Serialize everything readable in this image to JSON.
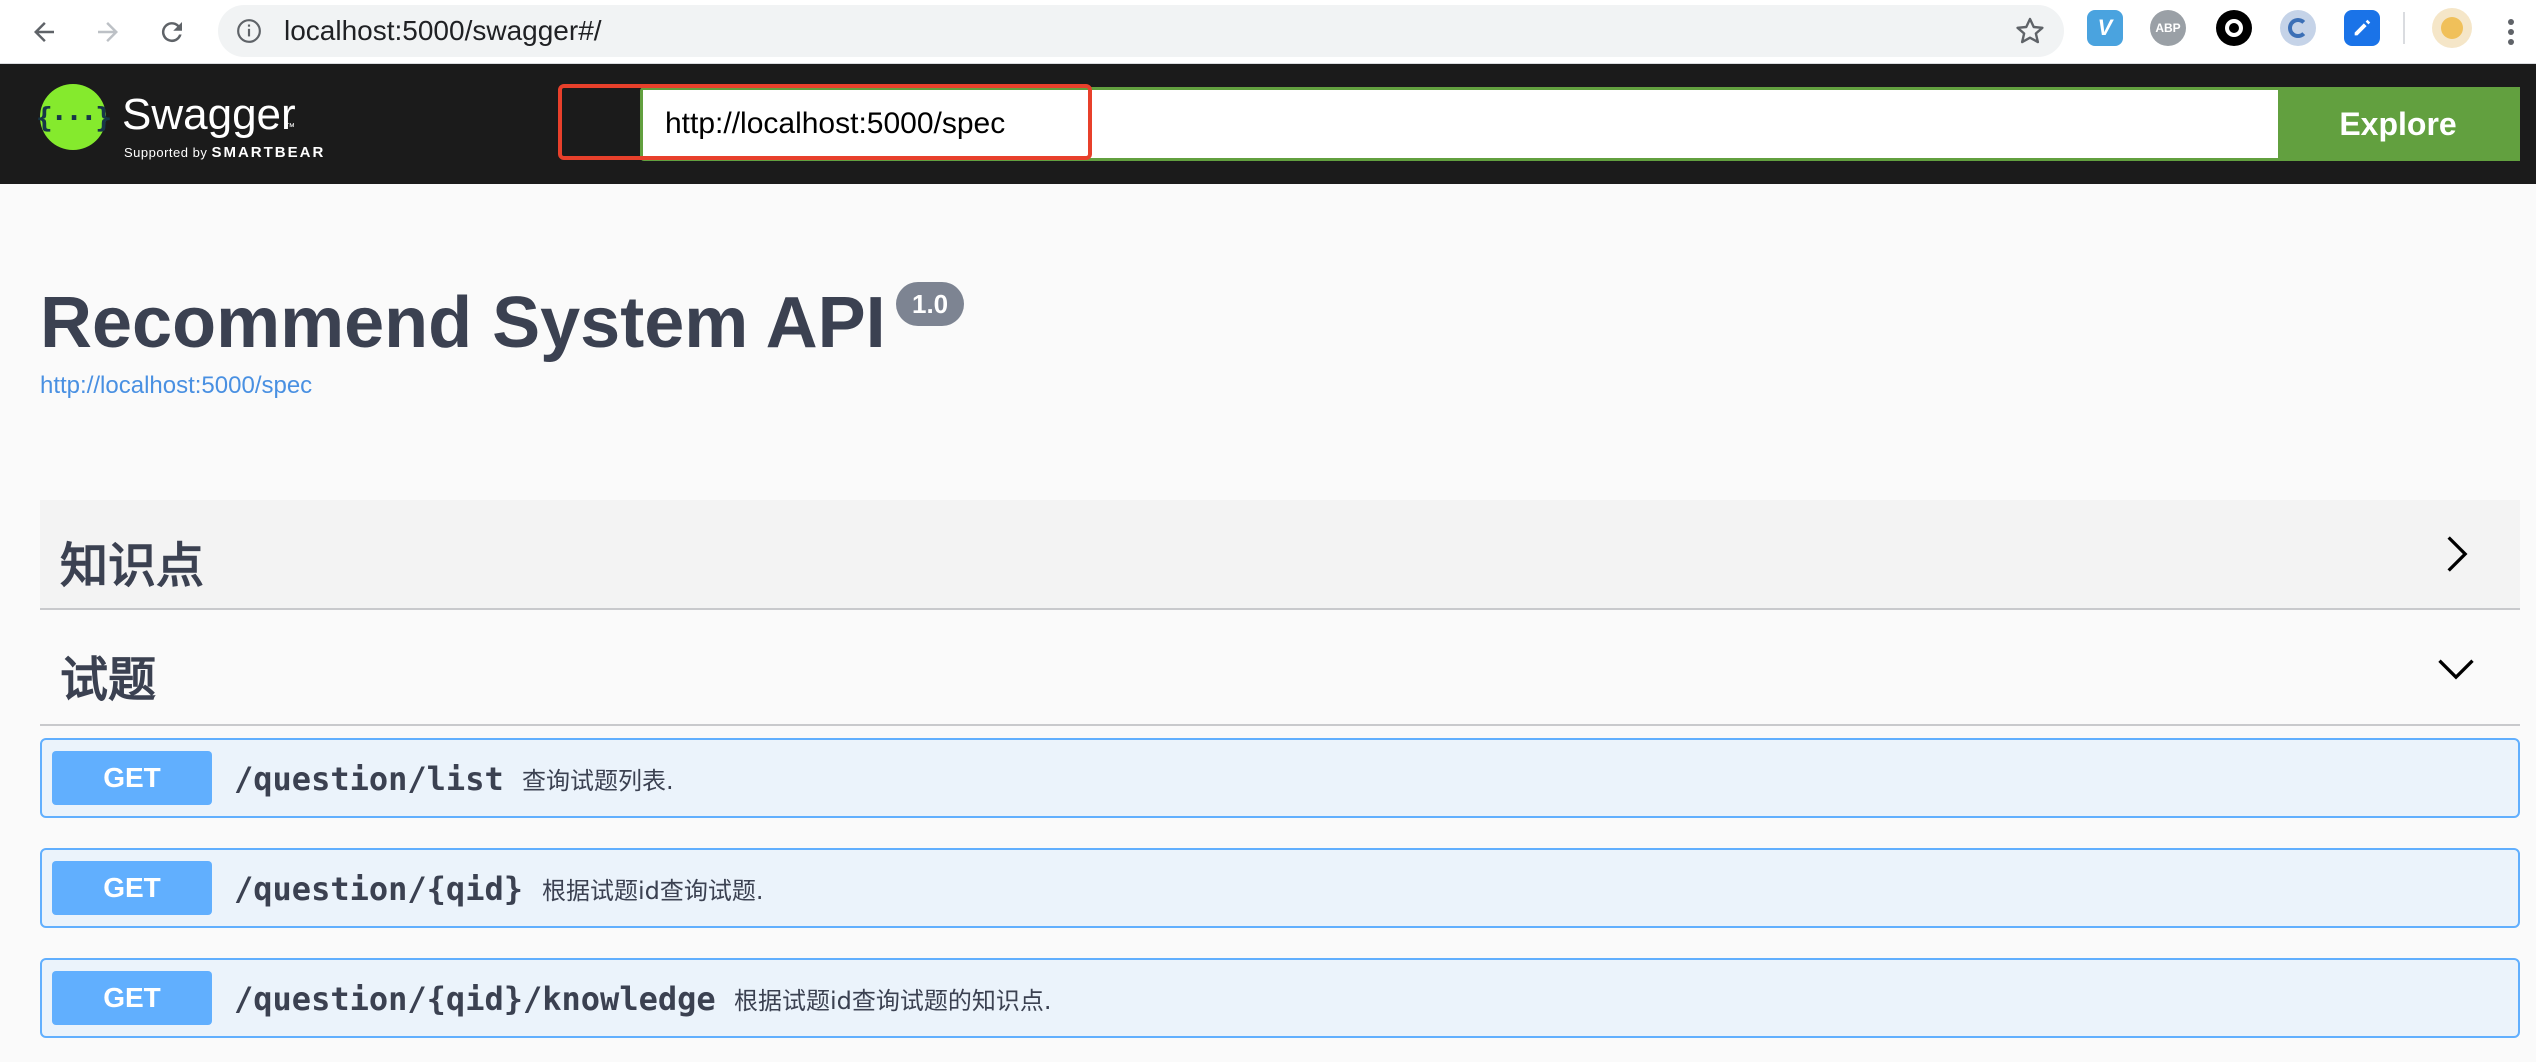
{
  "browser": {
    "address": "localhost:5000/swagger#/"
  },
  "topbar": {
    "logo_text": "Swagger",
    "logo_tm": "™",
    "logo_sub_prefix": "Supported by",
    "logo_sub_brand": "SMARTBEAR",
    "spec_url": "http://localhost:5000/spec",
    "explore_label": "Explore"
  },
  "info": {
    "title": "Recommend System API",
    "version": "1.0",
    "spec_link": "http://localhost:5000/spec"
  },
  "tags": [
    {
      "name": "知识点",
      "state": "collapsed"
    },
    {
      "name": "试题",
      "state": "expanded"
    }
  ],
  "operations": [
    {
      "method": "GET",
      "path": "/question/list",
      "summary": "查询试题列表."
    },
    {
      "method": "GET",
      "path": "/question/{qid}",
      "summary": "根据试题id查询试题."
    },
    {
      "method": "GET",
      "path": "/question/{qid}/knowledge",
      "summary": "根据试题id查询试题的知识点."
    }
  ],
  "colors": {
    "topbar_bg": "#1b1b1b",
    "explore_green": "#62a03f",
    "highlight_red": "#e8402b",
    "get_blue": "#61affe",
    "get_bg": "#ebf3fb",
    "title_text": "#3b4151"
  }
}
